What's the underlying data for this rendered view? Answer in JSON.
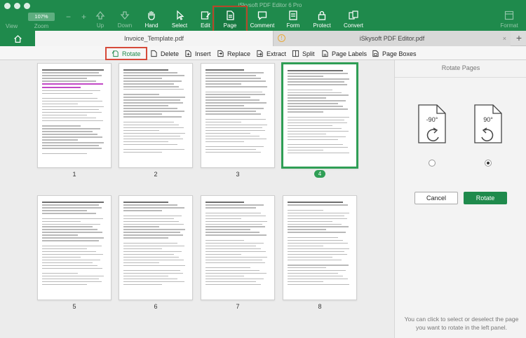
{
  "window": {
    "title": "iSkysoft PDF Editor 6 Pro"
  },
  "toolbar": {
    "view": "View",
    "zoom_value": "107%",
    "zoom_label": "Zoom",
    "zoom_minus": "−",
    "zoom_plus": "+",
    "items": [
      {
        "label": "Up",
        "icon": "arrow-up-icon"
      },
      {
        "label": "Down",
        "icon": "arrow-down-icon"
      },
      {
        "label": "Hand",
        "icon": "hand-icon"
      },
      {
        "label": "Select",
        "icon": "cursor-icon"
      },
      {
        "label": "Edit",
        "icon": "edit-icon"
      },
      {
        "label": "Page",
        "icon": "page-icon"
      },
      {
        "label": "Comment",
        "icon": "comment-icon"
      },
      {
        "label": "Form",
        "icon": "form-icon"
      },
      {
        "label": "Protect",
        "icon": "lock-icon"
      },
      {
        "label": "Convert",
        "icon": "convert-icon"
      },
      {
        "label": "Format",
        "icon": "format-icon"
      }
    ]
  },
  "tabs": [
    {
      "label": "Invoice_Template.pdf"
    },
    {
      "label": "iSkysoft PDF Editor.pdf",
      "warning": "!",
      "close": "×"
    }
  ],
  "add_tab": "+",
  "page_toolbar": {
    "rotate": "Rotate",
    "delete": "Delete",
    "insert": "Insert",
    "replace": "Replace",
    "extract": "Extract",
    "split": "Split",
    "page_labels": "Page Labels",
    "page_boxes": "Page Boxes"
  },
  "pages": [
    {
      "number": "1",
      "selected": false
    },
    {
      "number": "2",
      "selected": false
    },
    {
      "number": "3",
      "selected": false
    },
    {
      "number": "4",
      "selected": true
    },
    {
      "number": "5",
      "selected": false
    },
    {
      "number": "6",
      "selected": false
    },
    {
      "number": "7",
      "selected": false
    },
    {
      "number": "8",
      "selected": false
    }
  ],
  "panel": {
    "title": "Rotate Pages",
    "left_option": "-90°",
    "right_option": "90°",
    "selected_option": "90°",
    "cancel": "Cancel",
    "rotate": "Rotate",
    "hint": "You can click to select or deselect the page you want to rotate in the left panel."
  },
  "colors": {
    "accent": "#1f8a4c",
    "highlight": "#d64a3a",
    "selected_page": "#2f9e55"
  }
}
